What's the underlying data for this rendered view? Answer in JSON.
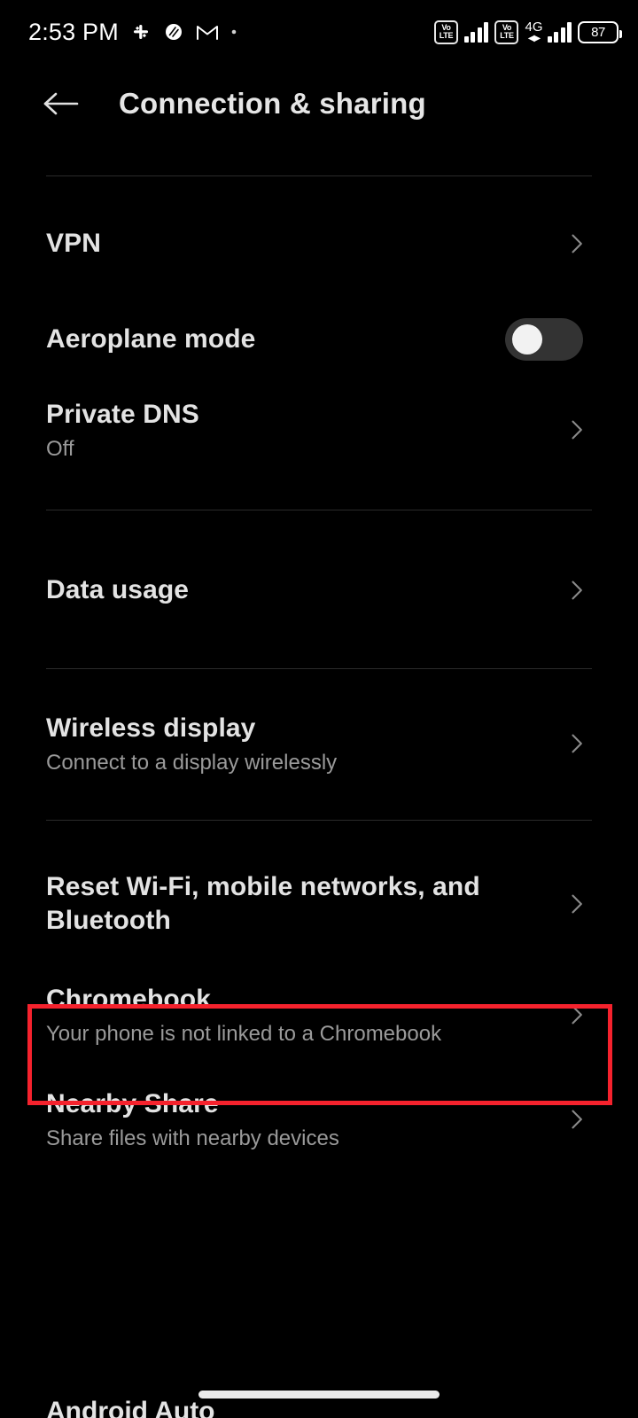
{
  "status_bar": {
    "time": "2:53 PM",
    "notification_icons": [
      "slack-icon",
      "app-icon",
      "gmail-icon",
      "dot-icon"
    ],
    "volte_label_top": "Vo",
    "volte_label_bottom": "LTE",
    "network_type": "4G",
    "battery_percent": "87"
  },
  "app_bar": {
    "back_label": "Back",
    "title": "Connection & sharing"
  },
  "list": {
    "items": [
      {
        "title": "VPN",
        "subtitle": "",
        "control": "chevron"
      },
      {
        "title": "Aeroplane mode",
        "subtitle": "",
        "control": "toggle",
        "toggle_state": "off"
      },
      {
        "title": "Private DNS",
        "subtitle": "Off",
        "control": "chevron"
      },
      {
        "title": "Data usage",
        "subtitle": "",
        "control": "chevron"
      },
      {
        "title": "Wireless display",
        "subtitle": "Connect to a display wirelessly",
        "control": "chevron"
      },
      {
        "title": "Reset Wi-Fi, mobile networks, and Bluetooth",
        "subtitle": "",
        "control": "chevron",
        "highlighted": true
      },
      {
        "title": "Chromebook",
        "subtitle": "Your phone is not linked to a Chromebook",
        "control": "chevron"
      },
      {
        "title": "Nearby Share",
        "subtitle": "Share files with nearby devices",
        "control": "chevron"
      },
      {
        "title": "Android Auto",
        "subtitle": "",
        "control": "chevron"
      }
    ]
  },
  "colors": {
    "background": "#000000",
    "primary_text": "#e3e3e3",
    "secondary_text": "#9a9a9a",
    "divider": "#2a2a2a",
    "highlight_border": "#f5222d",
    "toggle_track": "#333333",
    "toggle_knob": "#f2f2f2"
  }
}
